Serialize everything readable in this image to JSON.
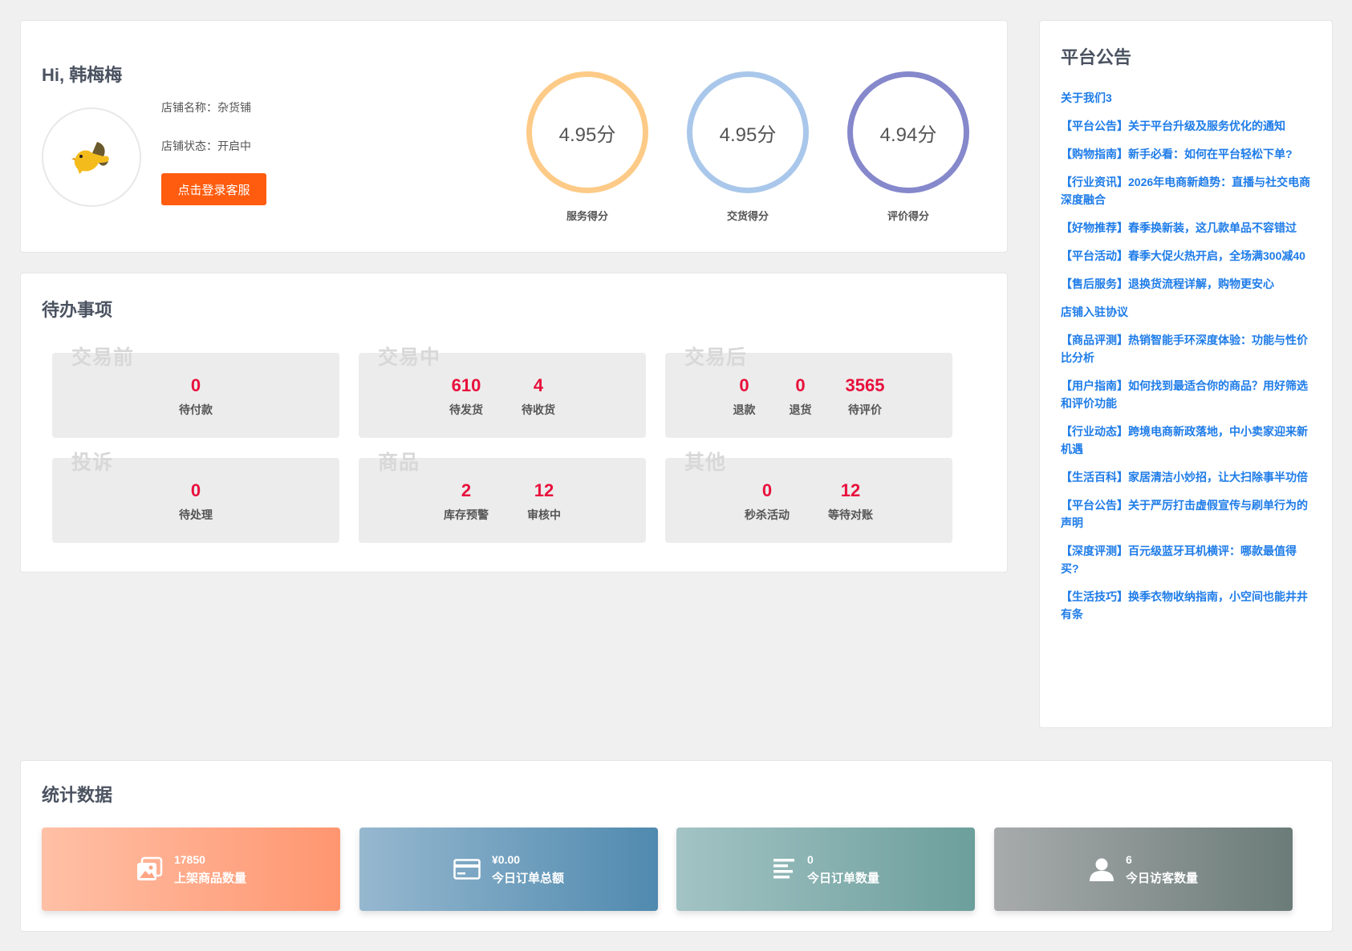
{
  "profile": {
    "greeting": "Hi, 韩梅梅",
    "shop_name_label": "店铺名称：",
    "shop_name": "杂货铺",
    "shop_status_label": "店铺状态：",
    "shop_status": "开启中",
    "cs_button": "点击登录客服"
  },
  "scores": [
    {
      "value": "4.95分",
      "label": "服务得分",
      "color": "#fdcb87"
    },
    {
      "value": "4.95分",
      "label": "交货得分",
      "color": "#a9c7ea"
    },
    {
      "value": "4.94分",
      "label": "评价得分",
      "color": "#8688cc"
    }
  ],
  "todo": {
    "title": "待办事项",
    "groups": [
      {
        "label": "交易前",
        "items": [
          {
            "num": "0",
            "label": "待付款"
          }
        ]
      },
      {
        "label": "交易中",
        "items": [
          {
            "num": "610",
            "label": "待发货"
          },
          {
            "num": "4",
            "label": "待收货"
          }
        ]
      },
      {
        "label": "交易后",
        "items": [
          {
            "num": "0",
            "label": "退款"
          },
          {
            "num": "0",
            "label": "退货"
          },
          {
            "num": "3565",
            "label": "待评价"
          }
        ]
      },
      {
        "label": "投诉",
        "items": [
          {
            "num": "0",
            "label": "待处理"
          }
        ]
      },
      {
        "label": "商品",
        "items": [
          {
            "num": "2",
            "label": "库存预警"
          },
          {
            "num": "12",
            "label": "审核中"
          }
        ]
      },
      {
        "label": "其他",
        "items": [
          {
            "num": "0",
            "label": "秒杀活动"
          },
          {
            "num": "12",
            "label": "等待对账"
          }
        ]
      }
    ]
  },
  "notice": {
    "title": "平台公告",
    "items": [
      "关于我们3",
      "【平台公告】关于平台升级及服务优化的通知",
      "【购物指南】新手必看：如何在平台轻松下单?",
      "【行业资讯】2026年电商新趋势：直播与社交电商深度融合",
      "【好物推荐】春季换新装，这几款单品不容错过",
      "【平台活动】春季大促火热开启，全场满300减40",
      "【售后服务】退换货流程详解，购物更安心",
      "店铺入驻协议",
      "【商品评测】热销智能手环深度体验：功能与性价比分析",
      "【用户指南】如何找到最适合你的商品？用好筛选和评价功能",
      "【行业动态】跨境电商新政落地，中小卖家迎来新机遇",
      "【生活百科】家居清洁小妙招，让大扫除事半功倍",
      "【平台公告】关于严厉打击虚假宣传与刷单行为的声明",
      "【深度评测】百元级蓝牙耳机横评：哪款最值得买?",
      "【生活技巧】换季衣物收纳指南，小空间也能井井有条"
    ]
  },
  "stats": {
    "title": "统计数据",
    "cards": [
      {
        "value": "17850",
        "label": "上架商品数量",
        "icon": "images-icon"
      },
      {
        "value": "¥0.00",
        "label": "今日订单总额",
        "icon": "credit-card-icon"
      },
      {
        "value": "0",
        "label": "今日订单数量",
        "icon": "list-icon"
      },
      {
        "value": "6",
        "label": "今日访客数量",
        "icon": "user-icon"
      }
    ]
  }
}
